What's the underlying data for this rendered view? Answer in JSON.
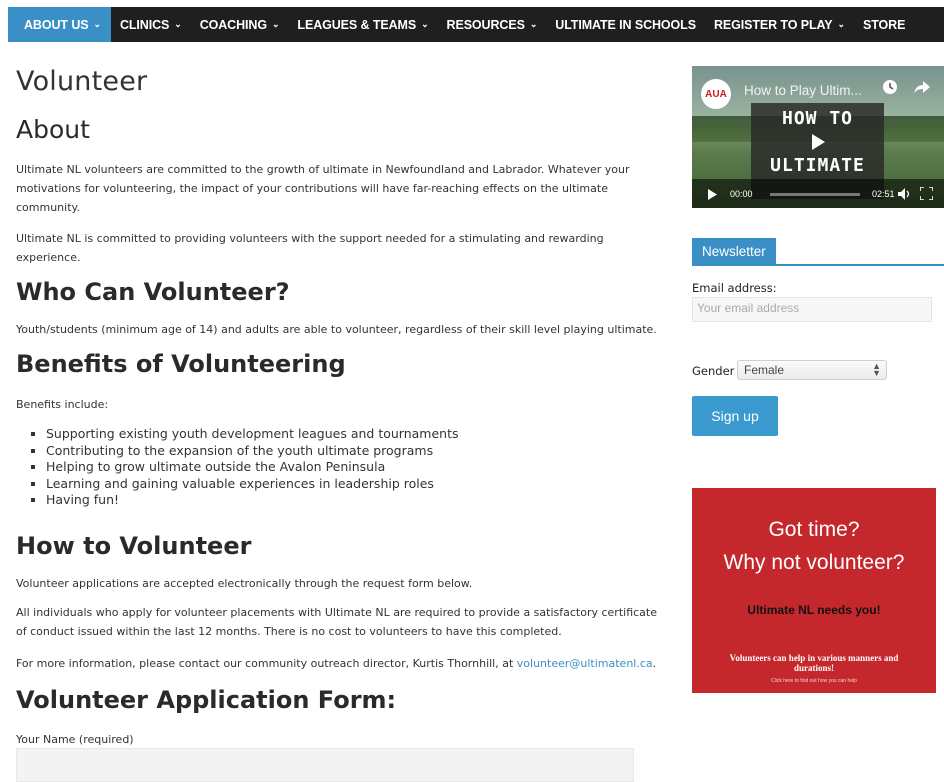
{
  "nav": {
    "items": [
      {
        "label": "ABOUT US",
        "dropdown": true,
        "active": true
      },
      {
        "label": "CLINICS",
        "dropdown": true
      },
      {
        "label": "COACHING",
        "dropdown": true
      },
      {
        "label": "LEAGUES & TEAMS",
        "dropdown": true
      },
      {
        "label": "RESOURCES",
        "dropdown": true
      },
      {
        "label": "ULTIMATE IN SCHOOLS",
        "dropdown": false
      },
      {
        "label": "REGISTER TO PLAY",
        "dropdown": true
      },
      {
        "label": "STORE",
        "dropdown": false
      }
    ],
    "chevron": "⌄"
  },
  "page": {
    "title": "Volunteer",
    "about_heading": "About",
    "about_p1": "Ultimate NL volunteers are committed to the growth of ultimate in Newfoundland and Labrador. Whatever your motivations for volunteering, the impact of your contributions will have far-reaching effects on the ultimate community.",
    "about_p2": "Ultimate NL is committed to providing volunteers with the support needed for a stimulating and rewarding experience.",
    "who_heading": "Who Can Volunteer?",
    "who_p": "Youth/students (minimum age of 14) and adults are able to volunteer, regardless of their skill level playing ultimate.",
    "benefits_heading": "Benefits of Volunteering",
    "benefits_intro": "Benefits include:",
    "benefits": [
      "Supporting existing youth development leagues and tournaments",
      "Contributing to the expansion of the youth ultimate programs",
      "Helping to grow ultimate outside the Avalon Peninsula",
      "Learning and gaining valuable experiences in leadership roles",
      "Having fun!"
    ],
    "how_heading": "How to Volunteer",
    "how_p1": "Volunteer applications are accepted electronically through the request form below.",
    "how_p2": "All individuals who apply for volunteer placements with Ultimate NL are required to provide a satisfactory certificate of conduct issued within the last 12 months. There is no cost to volunteers to have this completed.",
    "how_p3_prefix": "For more information, please contact our community outreach director, Kurtis Thornhill, at ",
    "how_p3_email": "volunteer@ultimatenl.ca",
    "how_p3_suffix": ".",
    "form_heading": "Volunteer Application Form:",
    "name_label": "Your Name (required)"
  },
  "video": {
    "channel_logo": "AUA",
    "title": "How to Play Ultim...",
    "overlay_line1": "HOW TO",
    "overlay_line2": "ULTIMATE",
    "time_current": "00:00",
    "time_duration": "02:51",
    "progress": 0
  },
  "newsletter": {
    "title": "Newsletter",
    "email_label": "Email address:",
    "email_placeholder": "Your email address",
    "gender_label": "Gender",
    "gender_value": "Female",
    "signup_label": "Sign up"
  },
  "promo": {
    "line1": "Got time?",
    "line2": "Why not volunteer?",
    "line3": "Ultimate NL needs you!",
    "line4": "Volunteers can help in various manners and durations!",
    "line5": "Click here to find out how you can help",
    "bg_color": "#c5282c"
  },
  "colors": {
    "accent": "#3a8fc7",
    "nav_bg": "#1f1f1f"
  }
}
